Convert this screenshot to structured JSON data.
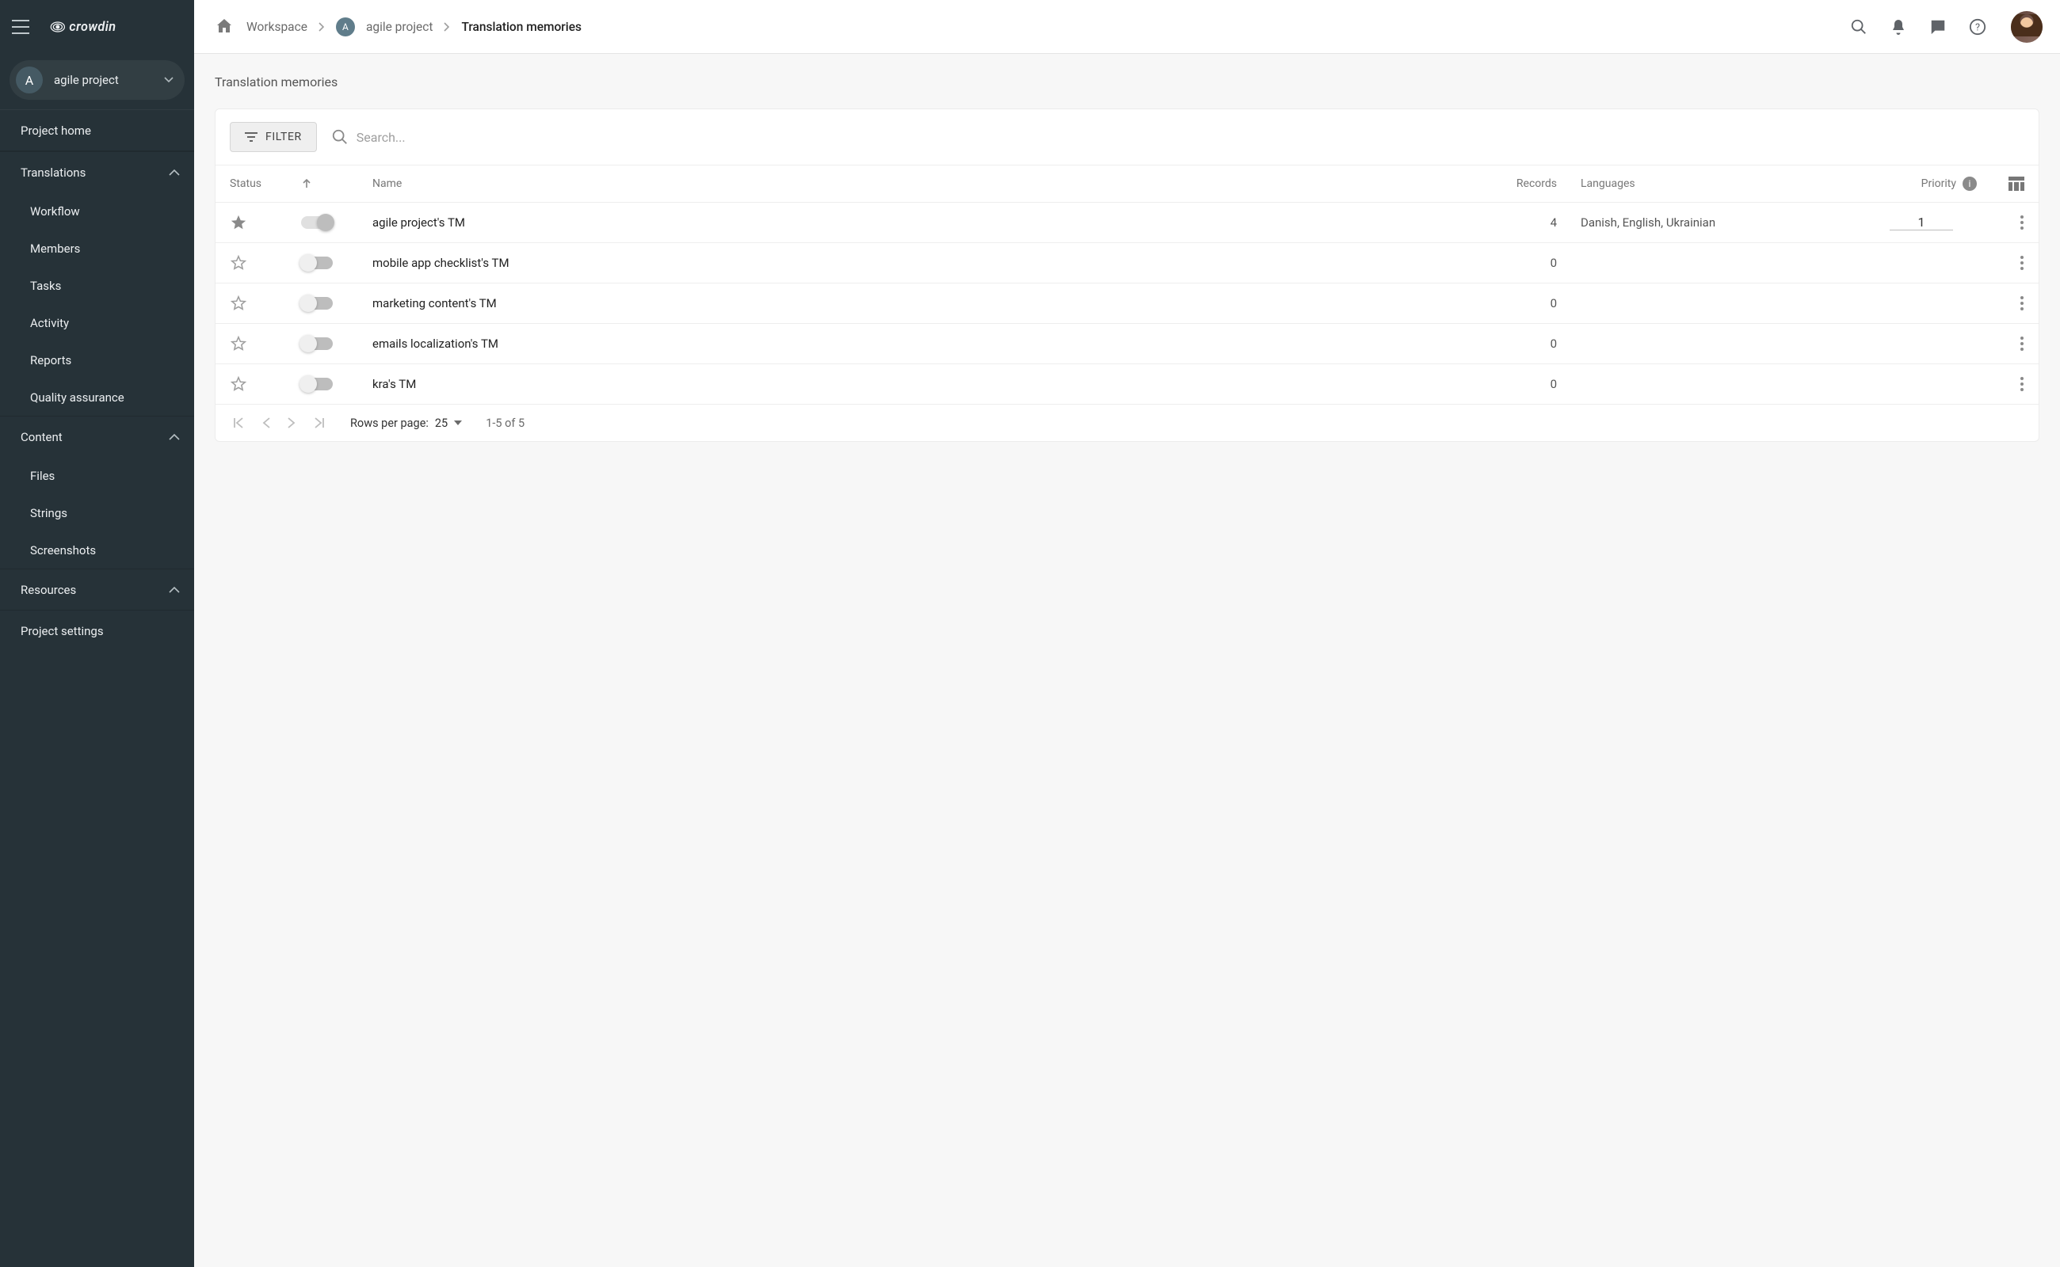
{
  "brand": "crowdin",
  "project": {
    "avatar_letter": "A",
    "name": "agile project"
  },
  "sidebar": {
    "project_home": "Project home",
    "sections": {
      "translations": {
        "title": "Translations",
        "items": [
          "Workflow",
          "Members",
          "Tasks",
          "Activity",
          "Reports",
          "Quality assurance"
        ]
      },
      "content": {
        "title": "Content",
        "items": [
          "Files",
          "Strings",
          "Screenshots"
        ]
      },
      "resources": {
        "title": "Resources"
      }
    },
    "project_settings": "Project settings"
  },
  "breadcrumbs": {
    "workspace": "Workspace",
    "project_avatar": "A",
    "project": "agile project",
    "current": "Translation memories"
  },
  "page": {
    "title": "Translation memories"
  },
  "toolbar": {
    "filter_label": "FILTER",
    "search_placeholder": "Search..."
  },
  "table": {
    "headers": {
      "status": "Status",
      "name": "Name",
      "records": "Records",
      "languages": "Languages",
      "priority": "Priority"
    },
    "rows": [
      {
        "starred": true,
        "enabled": true,
        "name": "agile project's TM",
        "records": "4",
        "languages": "Danish, English, Ukrainian",
        "priority": "1"
      },
      {
        "starred": false,
        "enabled": false,
        "name": "mobile app checklist's TM",
        "records": "0",
        "languages": "",
        "priority": ""
      },
      {
        "starred": false,
        "enabled": false,
        "name": "marketing content's TM",
        "records": "0",
        "languages": "",
        "priority": ""
      },
      {
        "starred": false,
        "enabled": false,
        "name": "emails localization's TM",
        "records": "0",
        "languages": "",
        "priority": ""
      },
      {
        "starred": false,
        "enabled": false,
        "name": "kra's TM",
        "records": "0",
        "languages": "",
        "priority": ""
      }
    ]
  },
  "pagination": {
    "rows_per_page_label": "Rows per page:",
    "rows_per_page_value": "25",
    "range": "1-5 of 5"
  }
}
